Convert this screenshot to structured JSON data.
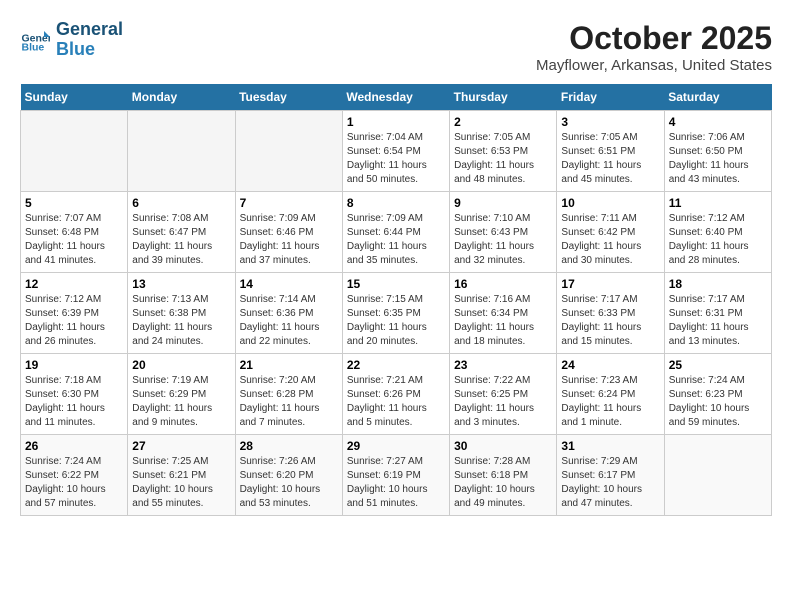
{
  "header": {
    "logo_line1": "General",
    "logo_line2": "Blue",
    "month": "October 2025",
    "location": "Mayflower, Arkansas, United States"
  },
  "days_of_week": [
    "Sunday",
    "Monday",
    "Tuesday",
    "Wednesday",
    "Thursday",
    "Friday",
    "Saturday"
  ],
  "weeks": [
    [
      {
        "day": "",
        "info": ""
      },
      {
        "day": "",
        "info": ""
      },
      {
        "day": "",
        "info": ""
      },
      {
        "day": "1",
        "info": "Sunrise: 7:04 AM\nSunset: 6:54 PM\nDaylight: 11 hours and 50 minutes."
      },
      {
        "day": "2",
        "info": "Sunrise: 7:05 AM\nSunset: 6:53 PM\nDaylight: 11 hours and 48 minutes."
      },
      {
        "day": "3",
        "info": "Sunrise: 7:05 AM\nSunset: 6:51 PM\nDaylight: 11 hours and 45 minutes."
      },
      {
        "day": "4",
        "info": "Sunrise: 7:06 AM\nSunset: 6:50 PM\nDaylight: 11 hours and 43 minutes."
      }
    ],
    [
      {
        "day": "5",
        "info": "Sunrise: 7:07 AM\nSunset: 6:48 PM\nDaylight: 11 hours and 41 minutes."
      },
      {
        "day": "6",
        "info": "Sunrise: 7:08 AM\nSunset: 6:47 PM\nDaylight: 11 hours and 39 minutes."
      },
      {
        "day": "7",
        "info": "Sunrise: 7:09 AM\nSunset: 6:46 PM\nDaylight: 11 hours and 37 minutes."
      },
      {
        "day": "8",
        "info": "Sunrise: 7:09 AM\nSunset: 6:44 PM\nDaylight: 11 hours and 35 minutes."
      },
      {
        "day": "9",
        "info": "Sunrise: 7:10 AM\nSunset: 6:43 PM\nDaylight: 11 hours and 32 minutes."
      },
      {
        "day": "10",
        "info": "Sunrise: 7:11 AM\nSunset: 6:42 PM\nDaylight: 11 hours and 30 minutes."
      },
      {
        "day": "11",
        "info": "Sunrise: 7:12 AM\nSunset: 6:40 PM\nDaylight: 11 hours and 28 minutes."
      }
    ],
    [
      {
        "day": "12",
        "info": "Sunrise: 7:12 AM\nSunset: 6:39 PM\nDaylight: 11 hours and 26 minutes."
      },
      {
        "day": "13",
        "info": "Sunrise: 7:13 AM\nSunset: 6:38 PM\nDaylight: 11 hours and 24 minutes."
      },
      {
        "day": "14",
        "info": "Sunrise: 7:14 AM\nSunset: 6:36 PM\nDaylight: 11 hours and 22 minutes."
      },
      {
        "day": "15",
        "info": "Sunrise: 7:15 AM\nSunset: 6:35 PM\nDaylight: 11 hours and 20 minutes."
      },
      {
        "day": "16",
        "info": "Sunrise: 7:16 AM\nSunset: 6:34 PM\nDaylight: 11 hours and 18 minutes."
      },
      {
        "day": "17",
        "info": "Sunrise: 7:17 AM\nSunset: 6:33 PM\nDaylight: 11 hours and 15 minutes."
      },
      {
        "day": "18",
        "info": "Sunrise: 7:17 AM\nSunset: 6:31 PM\nDaylight: 11 hours and 13 minutes."
      }
    ],
    [
      {
        "day": "19",
        "info": "Sunrise: 7:18 AM\nSunset: 6:30 PM\nDaylight: 11 hours and 11 minutes."
      },
      {
        "day": "20",
        "info": "Sunrise: 7:19 AM\nSunset: 6:29 PM\nDaylight: 11 hours and 9 minutes."
      },
      {
        "day": "21",
        "info": "Sunrise: 7:20 AM\nSunset: 6:28 PM\nDaylight: 11 hours and 7 minutes."
      },
      {
        "day": "22",
        "info": "Sunrise: 7:21 AM\nSunset: 6:26 PM\nDaylight: 11 hours and 5 minutes."
      },
      {
        "day": "23",
        "info": "Sunrise: 7:22 AM\nSunset: 6:25 PM\nDaylight: 11 hours and 3 minutes."
      },
      {
        "day": "24",
        "info": "Sunrise: 7:23 AM\nSunset: 6:24 PM\nDaylight: 11 hours and 1 minute."
      },
      {
        "day": "25",
        "info": "Sunrise: 7:24 AM\nSunset: 6:23 PM\nDaylight: 10 hours and 59 minutes."
      }
    ],
    [
      {
        "day": "26",
        "info": "Sunrise: 7:24 AM\nSunset: 6:22 PM\nDaylight: 10 hours and 57 minutes."
      },
      {
        "day": "27",
        "info": "Sunrise: 7:25 AM\nSunset: 6:21 PM\nDaylight: 10 hours and 55 minutes."
      },
      {
        "day": "28",
        "info": "Sunrise: 7:26 AM\nSunset: 6:20 PM\nDaylight: 10 hours and 53 minutes."
      },
      {
        "day": "29",
        "info": "Sunrise: 7:27 AM\nSunset: 6:19 PM\nDaylight: 10 hours and 51 minutes."
      },
      {
        "day": "30",
        "info": "Sunrise: 7:28 AM\nSunset: 6:18 PM\nDaylight: 10 hours and 49 minutes."
      },
      {
        "day": "31",
        "info": "Sunrise: 7:29 AM\nSunset: 6:17 PM\nDaylight: 10 hours and 47 minutes."
      },
      {
        "day": "",
        "info": ""
      }
    ]
  ]
}
